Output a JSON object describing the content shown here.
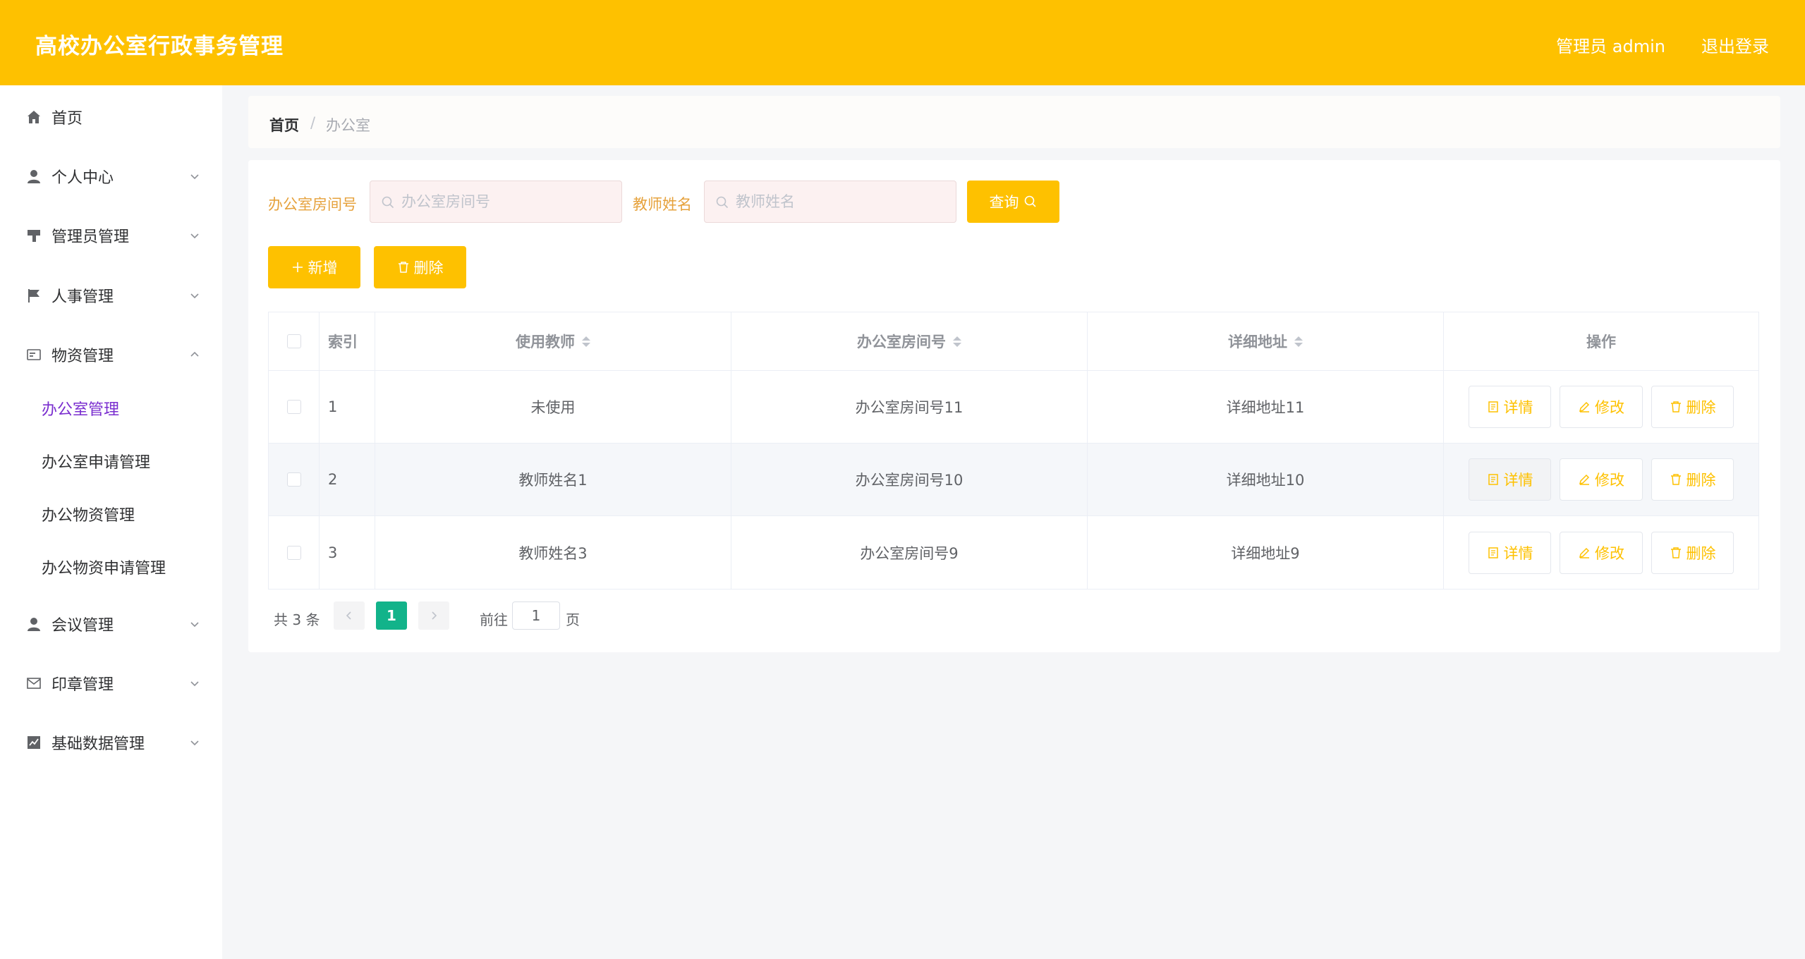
{
  "header": {
    "title": "高校办公室行政事务管理",
    "user": "管理员 admin",
    "logout": "退出登录"
  },
  "sidebar": {
    "items": [
      {
        "label": "首页",
        "icon": "home-icon"
      },
      {
        "label": "个人中心",
        "icon": "user-icon"
      },
      {
        "label": "管理员管理",
        "icon": "brush-icon"
      },
      {
        "label": "人事管理",
        "icon": "flag-icon"
      },
      {
        "label": "物资管理",
        "icon": "message-icon"
      },
      {
        "label": "会议管理",
        "icon": "user-icon"
      },
      {
        "label": "印章管理",
        "icon": "mail-icon"
      },
      {
        "label": "基础数据管理",
        "icon": "chart-icon"
      }
    ],
    "sub_items": [
      {
        "label": "办公室管理",
        "active": true
      },
      {
        "label": "办公室申请管理"
      },
      {
        "label": "办公物资管理"
      },
      {
        "label": "办公物资申请管理"
      }
    ]
  },
  "breadcrumb": {
    "home": "首页",
    "separator": "/",
    "current": "办公室"
  },
  "search": {
    "room_label": "办公室房间号",
    "room_placeholder": "办公室房间号",
    "teacher_label": "教师姓名",
    "teacher_placeholder": "教师姓名",
    "query_button": "查询"
  },
  "actions": {
    "add": "新增",
    "delete": "删除"
  },
  "table": {
    "headers": {
      "index": "索引",
      "teacher": "使用教师",
      "room": "办公室房间号",
      "address": "详细地址",
      "ops": "操作"
    },
    "rows": [
      {
        "index": "1",
        "teacher": "未使用",
        "room": "办公室房间号11",
        "address": "详细地址11"
      },
      {
        "index": "2",
        "teacher": "教师姓名1",
        "room": "办公室房间号10",
        "address": "详细地址10"
      },
      {
        "index": "3",
        "teacher": "教师姓名3",
        "room": "办公室房间号9",
        "address": "详细地址9"
      }
    ],
    "ops": {
      "detail": "详情",
      "edit": "修改",
      "delete": "删除"
    }
  },
  "pagination": {
    "total": "共 3 条",
    "current_page": "1",
    "goto_label": "前往",
    "goto_value": "1",
    "page_suffix": "页"
  },
  "colors": {
    "primary": "#fec100",
    "active_menu": "#7a2ecf",
    "pager_active": "#12b38a"
  }
}
